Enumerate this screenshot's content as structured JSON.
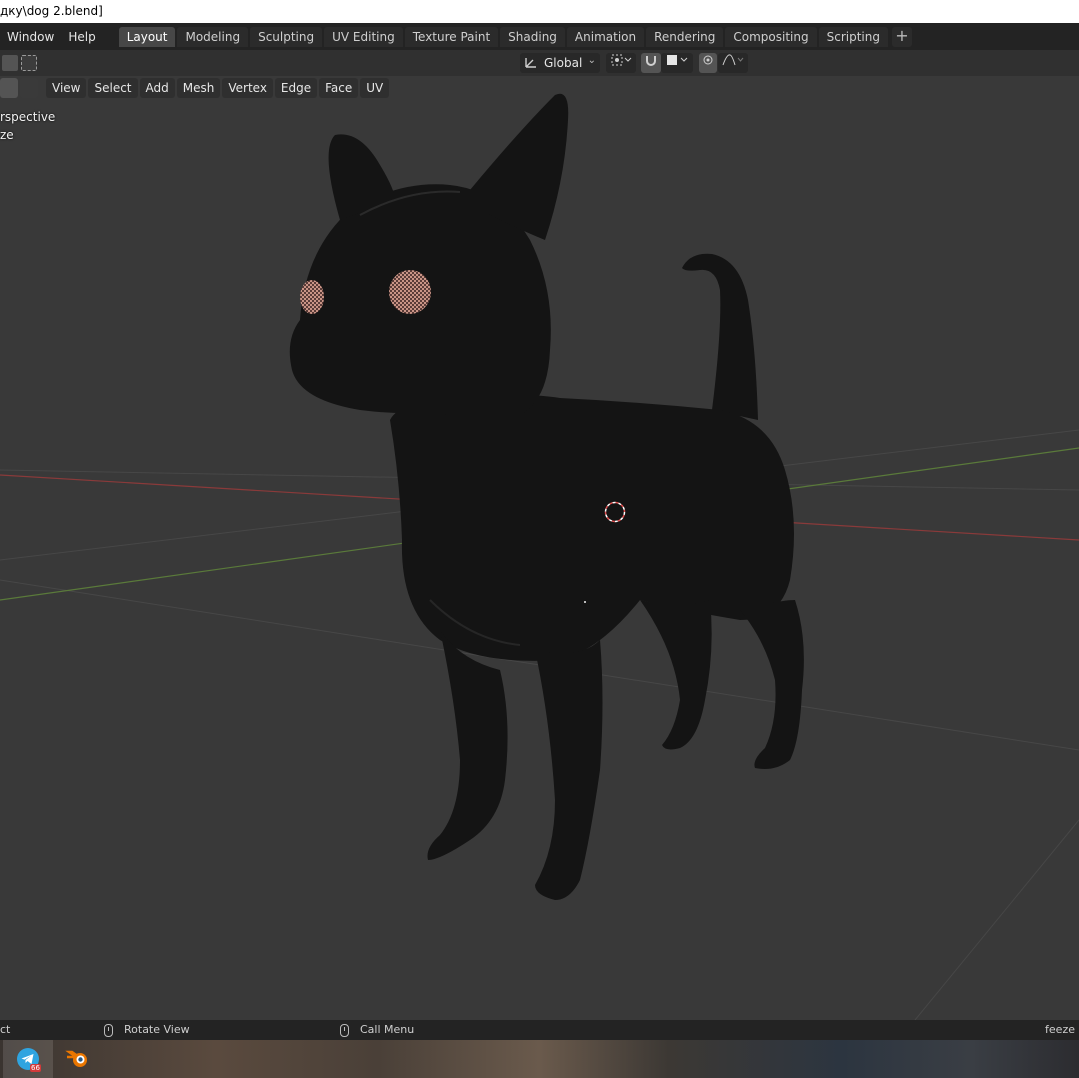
{
  "window": {
    "title": "дку\\dog 2.blend]"
  },
  "menubar": {
    "items": [
      "Window",
      "Help"
    ]
  },
  "workspaces": {
    "tabs": [
      "Layout",
      "Modeling",
      "Sculpting",
      "UV Editing",
      "Texture Paint",
      "Shading",
      "Animation",
      "Rendering",
      "Compositing",
      "Scripting"
    ],
    "active": "Layout",
    "add_label": "+"
  },
  "tool_header": {
    "orientation": "Global"
  },
  "view_header": {
    "menus": [
      "View",
      "Select",
      "Add",
      "Mesh",
      "Vertex",
      "Edge",
      "Face",
      "UV"
    ]
  },
  "viewport": {
    "overlay_line1": "rspective",
    "overlay_line2": "ze"
  },
  "status": {
    "left": "ct",
    "rotate": "Rotate View",
    "call_menu": "Call Menu",
    "right": "feeze"
  },
  "taskbar": {
    "telegram_badge": "66",
    "apps": [
      "telegram-icon",
      "blender-icon"
    ]
  },
  "colors": {
    "header_bg": "#232323",
    "active_tab": "#474747",
    "viewport_bg": "#393939",
    "x_axis": "#8a3a3a",
    "y_axis": "#5a7a3a",
    "cursor": "#e05050"
  }
}
